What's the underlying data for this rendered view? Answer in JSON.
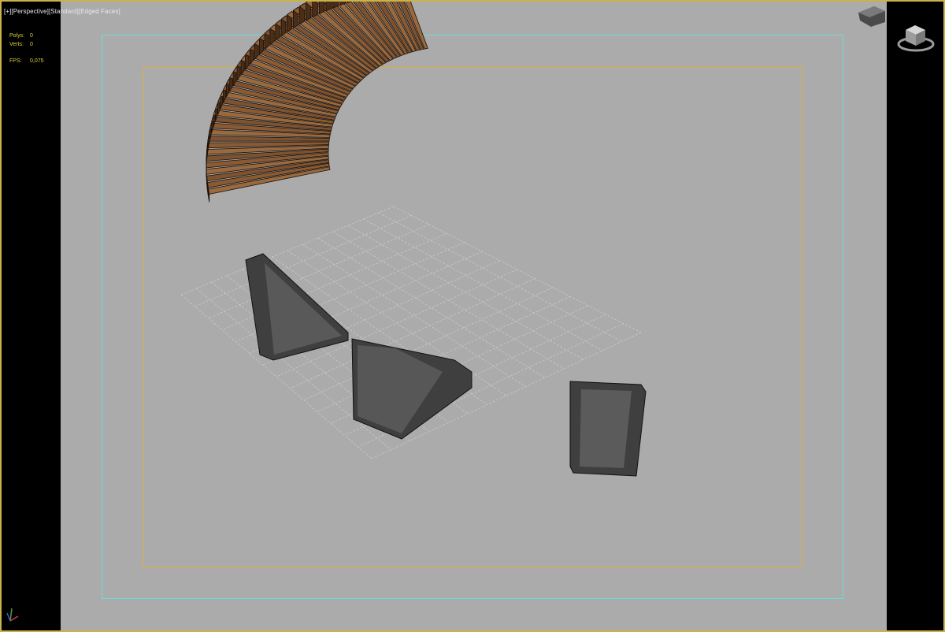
{
  "viewport": {
    "label_parts": [
      "[+]",
      "[Perspective]",
      "[Standard]",
      "[Edged Faces]"
    ],
    "stats": [
      {
        "key": "Polys:",
        "value": "0"
      },
      {
        "key": "Verts:",
        "value": "0"
      },
      {
        "key": "FPS:",
        "value": "0,075"
      }
    ]
  },
  "scene": {
    "object": "curved-wooden-bench",
    "slat_count": 46,
    "colors": {
      "background": "#ababab",
      "wood": "#8a5a33",
      "wood_dark": "#4a2e18",
      "leg": "#3f3f3f",
      "safe_frame": "#6fd9d9",
      "render_frame": "#d8b13a",
      "grid": "#c8c8c8",
      "stats_text": "#d9cf3e"
    }
  },
  "icons": {
    "viewcube": "viewcube-icon",
    "axis": "axis-tripod-icon"
  }
}
